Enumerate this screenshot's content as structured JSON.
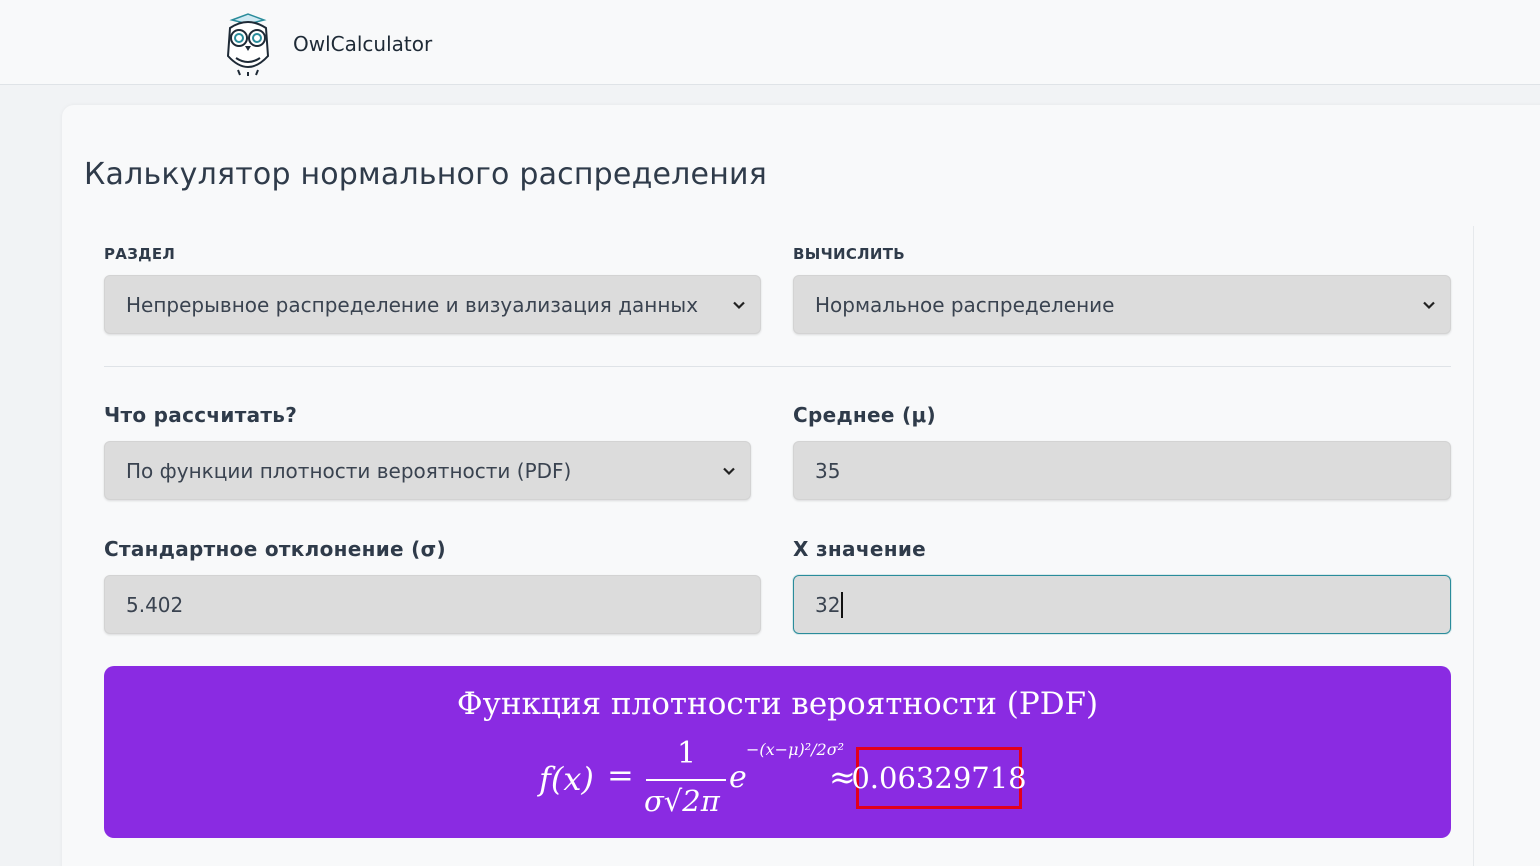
{
  "app": {
    "name": "OwlCalculator"
  },
  "page": {
    "title": "Калькулятор нормального распределения"
  },
  "form": {
    "section": {
      "label": "РАЗДЕЛ",
      "value": "Непрерывное распределение и визуализация данных"
    },
    "compute": {
      "label": "ВЫЧИСЛИТЬ",
      "value": "Нормальное распределение"
    },
    "what": {
      "label": "Что рассчитать?",
      "value": "По функции плотности вероятности (PDF)"
    },
    "mean": {
      "label": "Среднее (μ)",
      "value": "35"
    },
    "stddev": {
      "label": "Стандартное отклонение (σ)",
      "value": "5.402"
    },
    "x": {
      "label": "X значение",
      "value": "32"
    }
  },
  "result": {
    "title": "Функция плотности вероятности (PDF)",
    "formula": {
      "lhs": "f(x)",
      "equals": "=",
      "numerator": "1",
      "denominator": "σ√2π",
      "base": "e",
      "exponent": "−(x−μ)²/2σ²",
      "approx": "≈"
    },
    "value": "0.06329718"
  },
  "colors": {
    "result_bg": "#8a2be2",
    "highlight": "#e3001b",
    "focus": "#2a8c9b"
  }
}
